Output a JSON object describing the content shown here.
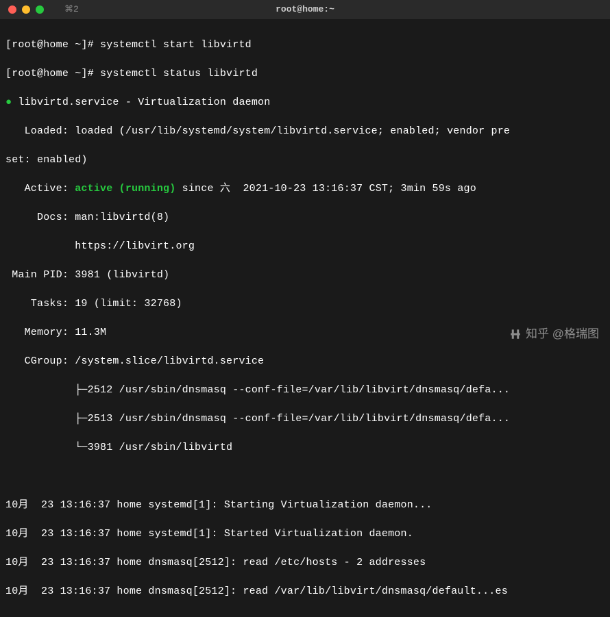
{
  "titlebar": {
    "tab": "⌘2",
    "title": "root@home:~"
  },
  "prompt": {
    "full": "[root@home ~]# "
  },
  "commands": {
    "cmd1": "systemctl start libvirtd",
    "cmd2": "systemctl status libvirtd"
  },
  "status": {
    "service_line": "libvirtd.service - Virtualization daemon",
    "loaded_label": "   Loaded: ",
    "loaded_value": "loaded (/usr/lib/systemd/system/libvirtd.service; enabled; vendor pre",
    "loaded_wrap": "set: enabled)",
    "active_label": "   Active: ",
    "active_value": "active (running)",
    "active_since": " since 六  2021-10-23 13:16:37 CST; 3min 59s ago",
    "docs_label": "     Docs: ",
    "docs_value1": "man:libvirtd(8)",
    "docs_value2": "           https://libvirt.org",
    "mainpid_label": " Main PID: ",
    "mainpid_value": "3981 (libvirtd)",
    "tasks_label": "    Tasks: ",
    "tasks_value": "19 (limit: 32768)",
    "memory_label": "   Memory: ",
    "memory_value": "11.3M",
    "cgroup_label": "   CGroup: ",
    "cgroup_value": "/system.slice/libvirtd.service",
    "cgroup_child1": "           ├─2512 /usr/sbin/dnsmasq --conf-file=/var/lib/libvirt/dnsmasq/defa...",
    "cgroup_child2": "           ├─2513 /usr/sbin/dnsmasq --conf-file=/var/lib/libvirt/dnsmasq/defa...",
    "cgroup_child3": "           └─3981 /usr/sbin/libvirtd"
  },
  "logs": {
    "l1": "10月  23 13:16:37 home systemd[1]: Starting Virtualization daemon...",
    "l2": "10月  23 13:16:37 home systemd[1]: Started Virtualization daemon.",
    "l3": "10月  23 13:16:37 home dnsmasq[2512]: read /etc/hosts - 2 addresses",
    "l4": "10月  23 13:16:37 home dnsmasq[2512]: read /var/lib/libvirt/dnsmasq/default...es"
  },
  "watermark": {
    "text": "知乎 @格瑞图"
  }
}
